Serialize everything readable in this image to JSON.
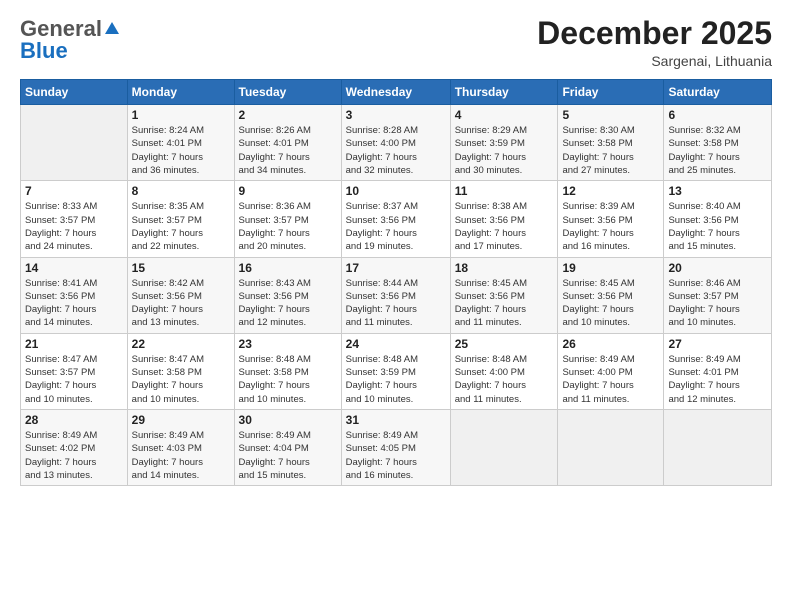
{
  "logo": {
    "general": "General",
    "blue": "Blue"
  },
  "header": {
    "month": "December 2025",
    "location": "Sargenai, Lithuania"
  },
  "weekdays": [
    "Sunday",
    "Monday",
    "Tuesday",
    "Wednesday",
    "Thursday",
    "Friday",
    "Saturday"
  ],
  "weeks": [
    [
      {
        "day": "",
        "info": ""
      },
      {
        "day": "1",
        "info": "Sunrise: 8:24 AM\nSunset: 4:01 PM\nDaylight: 7 hours\nand 36 minutes."
      },
      {
        "day": "2",
        "info": "Sunrise: 8:26 AM\nSunset: 4:01 PM\nDaylight: 7 hours\nand 34 minutes."
      },
      {
        "day": "3",
        "info": "Sunrise: 8:28 AM\nSunset: 4:00 PM\nDaylight: 7 hours\nand 32 minutes."
      },
      {
        "day": "4",
        "info": "Sunrise: 8:29 AM\nSunset: 3:59 PM\nDaylight: 7 hours\nand 30 minutes."
      },
      {
        "day": "5",
        "info": "Sunrise: 8:30 AM\nSunset: 3:58 PM\nDaylight: 7 hours\nand 27 minutes."
      },
      {
        "day": "6",
        "info": "Sunrise: 8:32 AM\nSunset: 3:58 PM\nDaylight: 7 hours\nand 25 minutes."
      }
    ],
    [
      {
        "day": "7",
        "info": "Sunrise: 8:33 AM\nSunset: 3:57 PM\nDaylight: 7 hours\nand 24 minutes."
      },
      {
        "day": "8",
        "info": "Sunrise: 8:35 AM\nSunset: 3:57 PM\nDaylight: 7 hours\nand 22 minutes."
      },
      {
        "day": "9",
        "info": "Sunrise: 8:36 AM\nSunset: 3:57 PM\nDaylight: 7 hours\nand 20 minutes."
      },
      {
        "day": "10",
        "info": "Sunrise: 8:37 AM\nSunset: 3:56 PM\nDaylight: 7 hours\nand 19 minutes."
      },
      {
        "day": "11",
        "info": "Sunrise: 8:38 AM\nSunset: 3:56 PM\nDaylight: 7 hours\nand 17 minutes."
      },
      {
        "day": "12",
        "info": "Sunrise: 8:39 AM\nSunset: 3:56 PM\nDaylight: 7 hours\nand 16 minutes."
      },
      {
        "day": "13",
        "info": "Sunrise: 8:40 AM\nSunset: 3:56 PM\nDaylight: 7 hours\nand 15 minutes."
      }
    ],
    [
      {
        "day": "14",
        "info": "Sunrise: 8:41 AM\nSunset: 3:56 PM\nDaylight: 7 hours\nand 14 minutes."
      },
      {
        "day": "15",
        "info": "Sunrise: 8:42 AM\nSunset: 3:56 PM\nDaylight: 7 hours\nand 13 minutes."
      },
      {
        "day": "16",
        "info": "Sunrise: 8:43 AM\nSunset: 3:56 PM\nDaylight: 7 hours\nand 12 minutes."
      },
      {
        "day": "17",
        "info": "Sunrise: 8:44 AM\nSunset: 3:56 PM\nDaylight: 7 hours\nand 11 minutes."
      },
      {
        "day": "18",
        "info": "Sunrise: 8:45 AM\nSunset: 3:56 PM\nDaylight: 7 hours\nand 11 minutes."
      },
      {
        "day": "19",
        "info": "Sunrise: 8:45 AM\nSunset: 3:56 PM\nDaylight: 7 hours\nand 10 minutes."
      },
      {
        "day": "20",
        "info": "Sunrise: 8:46 AM\nSunset: 3:57 PM\nDaylight: 7 hours\nand 10 minutes."
      }
    ],
    [
      {
        "day": "21",
        "info": "Sunrise: 8:47 AM\nSunset: 3:57 PM\nDaylight: 7 hours\nand 10 minutes."
      },
      {
        "day": "22",
        "info": "Sunrise: 8:47 AM\nSunset: 3:58 PM\nDaylight: 7 hours\nand 10 minutes."
      },
      {
        "day": "23",
        "info": "Sunrise: 8:48 AM\nSunset: 3:58 PM\nDaylight: 7 hours\nand 10 minutes."
      },
      {
        "day": "24",
        "info": "Sunrise: 8:48 AM\nSunset: 3:59 PM\nDaylight: 7 hours\nand 10 minutes."
      },
      {
        "day": "25",
        "info": "Sunrise: 8:48 AM\nSunset: 4:00 PM\nDaylight: 7 hours\nand 11 minutes."
      },
      {
        "day": "26",
        "info": "Sunrise: 8:49 AM\nSunset: 4:00 PM\nDaylight: 7 hours\nand 11 minutes."
      },
      {
        "day": "27",
        "info": "Sunrise: 8:49 AM\nSunset: 4:01 PM\nDaylight: 7 hours\nand 12 minutes."
      }
    ],
    [
      {
        "day": "28",
        "info": "Sunrise: 8:49 AM\nSunset: 4:02 PM\nDaylight: 7 hours\nand 13 minutes."
      },
      {
        "day": "29",
        "info": "Sunrise: 8:49 AM\nSunset: 4:03 PM\nDaylight: 7 hours\nand 14 minutes."
      },
      {
        "day": "30",
        "info": "Sunrise: 8:49 AM\nSunset: 4:04 PM\nDaylight: 7 hours\nand 15 minutes."
      },
      {
        "day": "31",
        "info": "Sunrise: 8:49 AM\nSunset: 4:05 PM\nDaylight: 7 hours\nand 16 minutes."
      },
      {
        "day": "",
        "info": ""
      },
      {
        "day": "",
        "info": ""
      },
      {
        "day": "",
        "info": ""
      }
    ]
  ]
}
